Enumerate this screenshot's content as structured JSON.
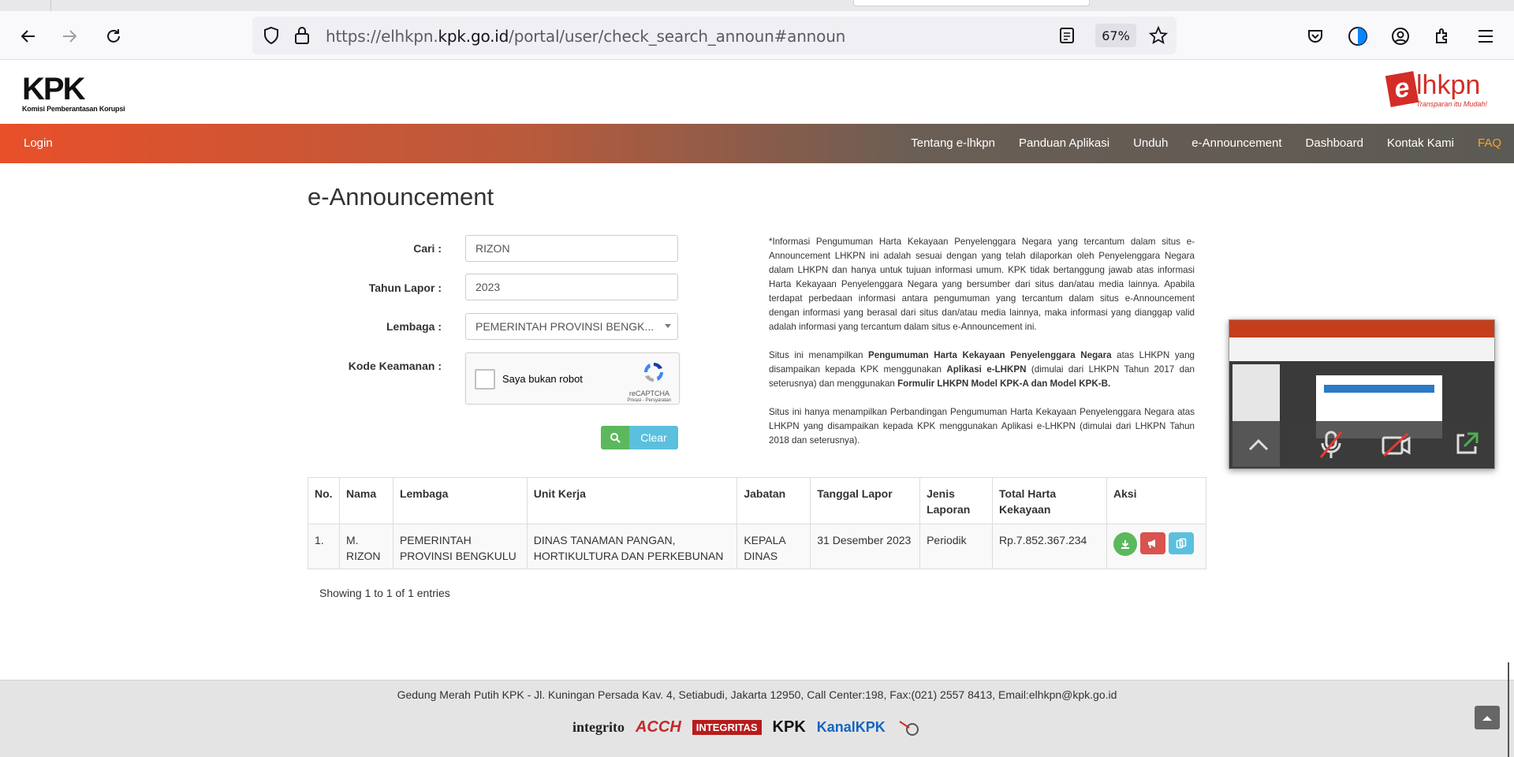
{
  "browser": {
    "url_prefix": "https://elhkpn.",
    "url_domain": "kpk.go.id",
    "url_suffix": "/portal/user/check_search_announ#announ",
    "zoom": "67%"
  },
  "header": {
    "kpk_logo": "KPK",
    "kpk_subtitle": "Komisi Pemberantasan Korupsi",
    "elhkpn_e": "e",
    "elhkpn_rest": "lhkpn",
    "elhkpn_tagline": "Transparan itu Mudah!"
  },
  "nav": {
    "login": "Login",
    "items": [
      "Tentang e-lhkpn",
      "Panduan Aplikasi",
      "Unduh",
      "e-Announcement",
      "Dashboard",
      "Kontak Kami",
      "FAQ"
    ]
  },
  "page": {
    "title": "e-Announcement"
  },
  "form": {
    "cari_label": "Cari :",
    "cari_value": "RIZON",
    "tahun_label": "Tahun Lapor :",
    "tahun_value": "2023",
    "lembaga_label": "Lembaga :",
    "lembaga_value": "PEMERINTAH PROVINSI BENGK...",
    "kode_label": "Kode Keamanan :",
    "captcha_text": "Saya bukan robot",
    "captcha_brand": "reCAPTCHA",
    "captcha_links": "Privasi - Persyaratan",
    "clear_label": "Clear"
  },
  "info": {
    "p1": "*Informasi Pengumuman Harta Kekayaan Penyelenggara Negara yang tercantum dalam situs e-Announcement LHKPN ini adalah sesuai dengan yang telah dilaporkan oleh Penyelenggara Negara dalam LHKPN dan hanya untuk tujuan informasi umum. KPK tidak bertanggung jawab atas informasi Harta Kekayaan Penyelenggara Negara yang bersumber dari situs dan/atau media lainnya. Apabila terdapat perbedaan informasi antara pengumuman yang tercantum dalam situs e-Announcement dengan informasi yang berasal dari situs dan/atau media lainnya, maka informasi yang dianggap valid adalah informasi yang tercantum dalam situs e-Announcement ini.",
    "p2_a": "Situs ini menampilkan ",
    "p2_b": "Pengumuman Harta Kekayaan Penyelenggara Negara",
    "p2_c": " atas LHKPN yang disampaikan kepada KPK menggunakan ",
    "p2_d": "Aplikasi e-LHKPN",
    "p2_e": " (dimulai dari LHKPN Tahun 2017 dan seterusnya) dan menggunakan ",
    "p2_f": "Formulir LHKPN Model KPK-A dan Model KPK-B.",
    "p3": "Situs ini hanya menampilkan Perbandingan Pengumuman Harta Kekayaan Penyelenggara Negara atas LHKPN yang disampaikan kepada KPK menggunakan Aplikasi e-LHKPN (dimulai dari LHKPN Tahun 2018 dan seterusnya)."
  },
  "table": {
    "headers": [
      "No.",
      "Nama",
      "Lembaga",
      "Unit Kerja",
      "Jabatan",
      "Tanggal Lapor",
      "Jenis Laporan",
      "Total Harta Kekayaan",
      "Aksi"
    ],
    "rows": [
      [
        "1.",
        "M. RIZON",
        "PEMERINTAH PROVINSI BENGKULU",
        "DINAS TANAMAN PANGAN, HORTIKULTURA DAN PERKEBUNAN",
        "KEPALA DINAS",
        "31 Desember 2023",
        "Periodik",
        "Rp.7.852.367.234"
      ]
    ],
    "showing": "Showing 1 to 1 of 1 entries"
  },
  "footer": {
    "address": "Gedung Merah Putih KPK - Jl. Kuningan Persada Kav. 4, Setiabudi, Jakarta 12950, Call Center:198, Fax:(021) 2557 8413, Email:elhkpn@kpk.go.id",
    "logos": [
      "integrito",
      "ACCH",
      "INTEGRITAS",
      "KPK",
      "KanalKPK"
    ]
  },
  "colors": {
    "accent_orange": "#e8502a",
    "faq": "#f5a623",
    "btn_green": "#5cb85c",
    "btn_red": "#d9534f",
    "btn_info": "#5bc0de"
  }
}
